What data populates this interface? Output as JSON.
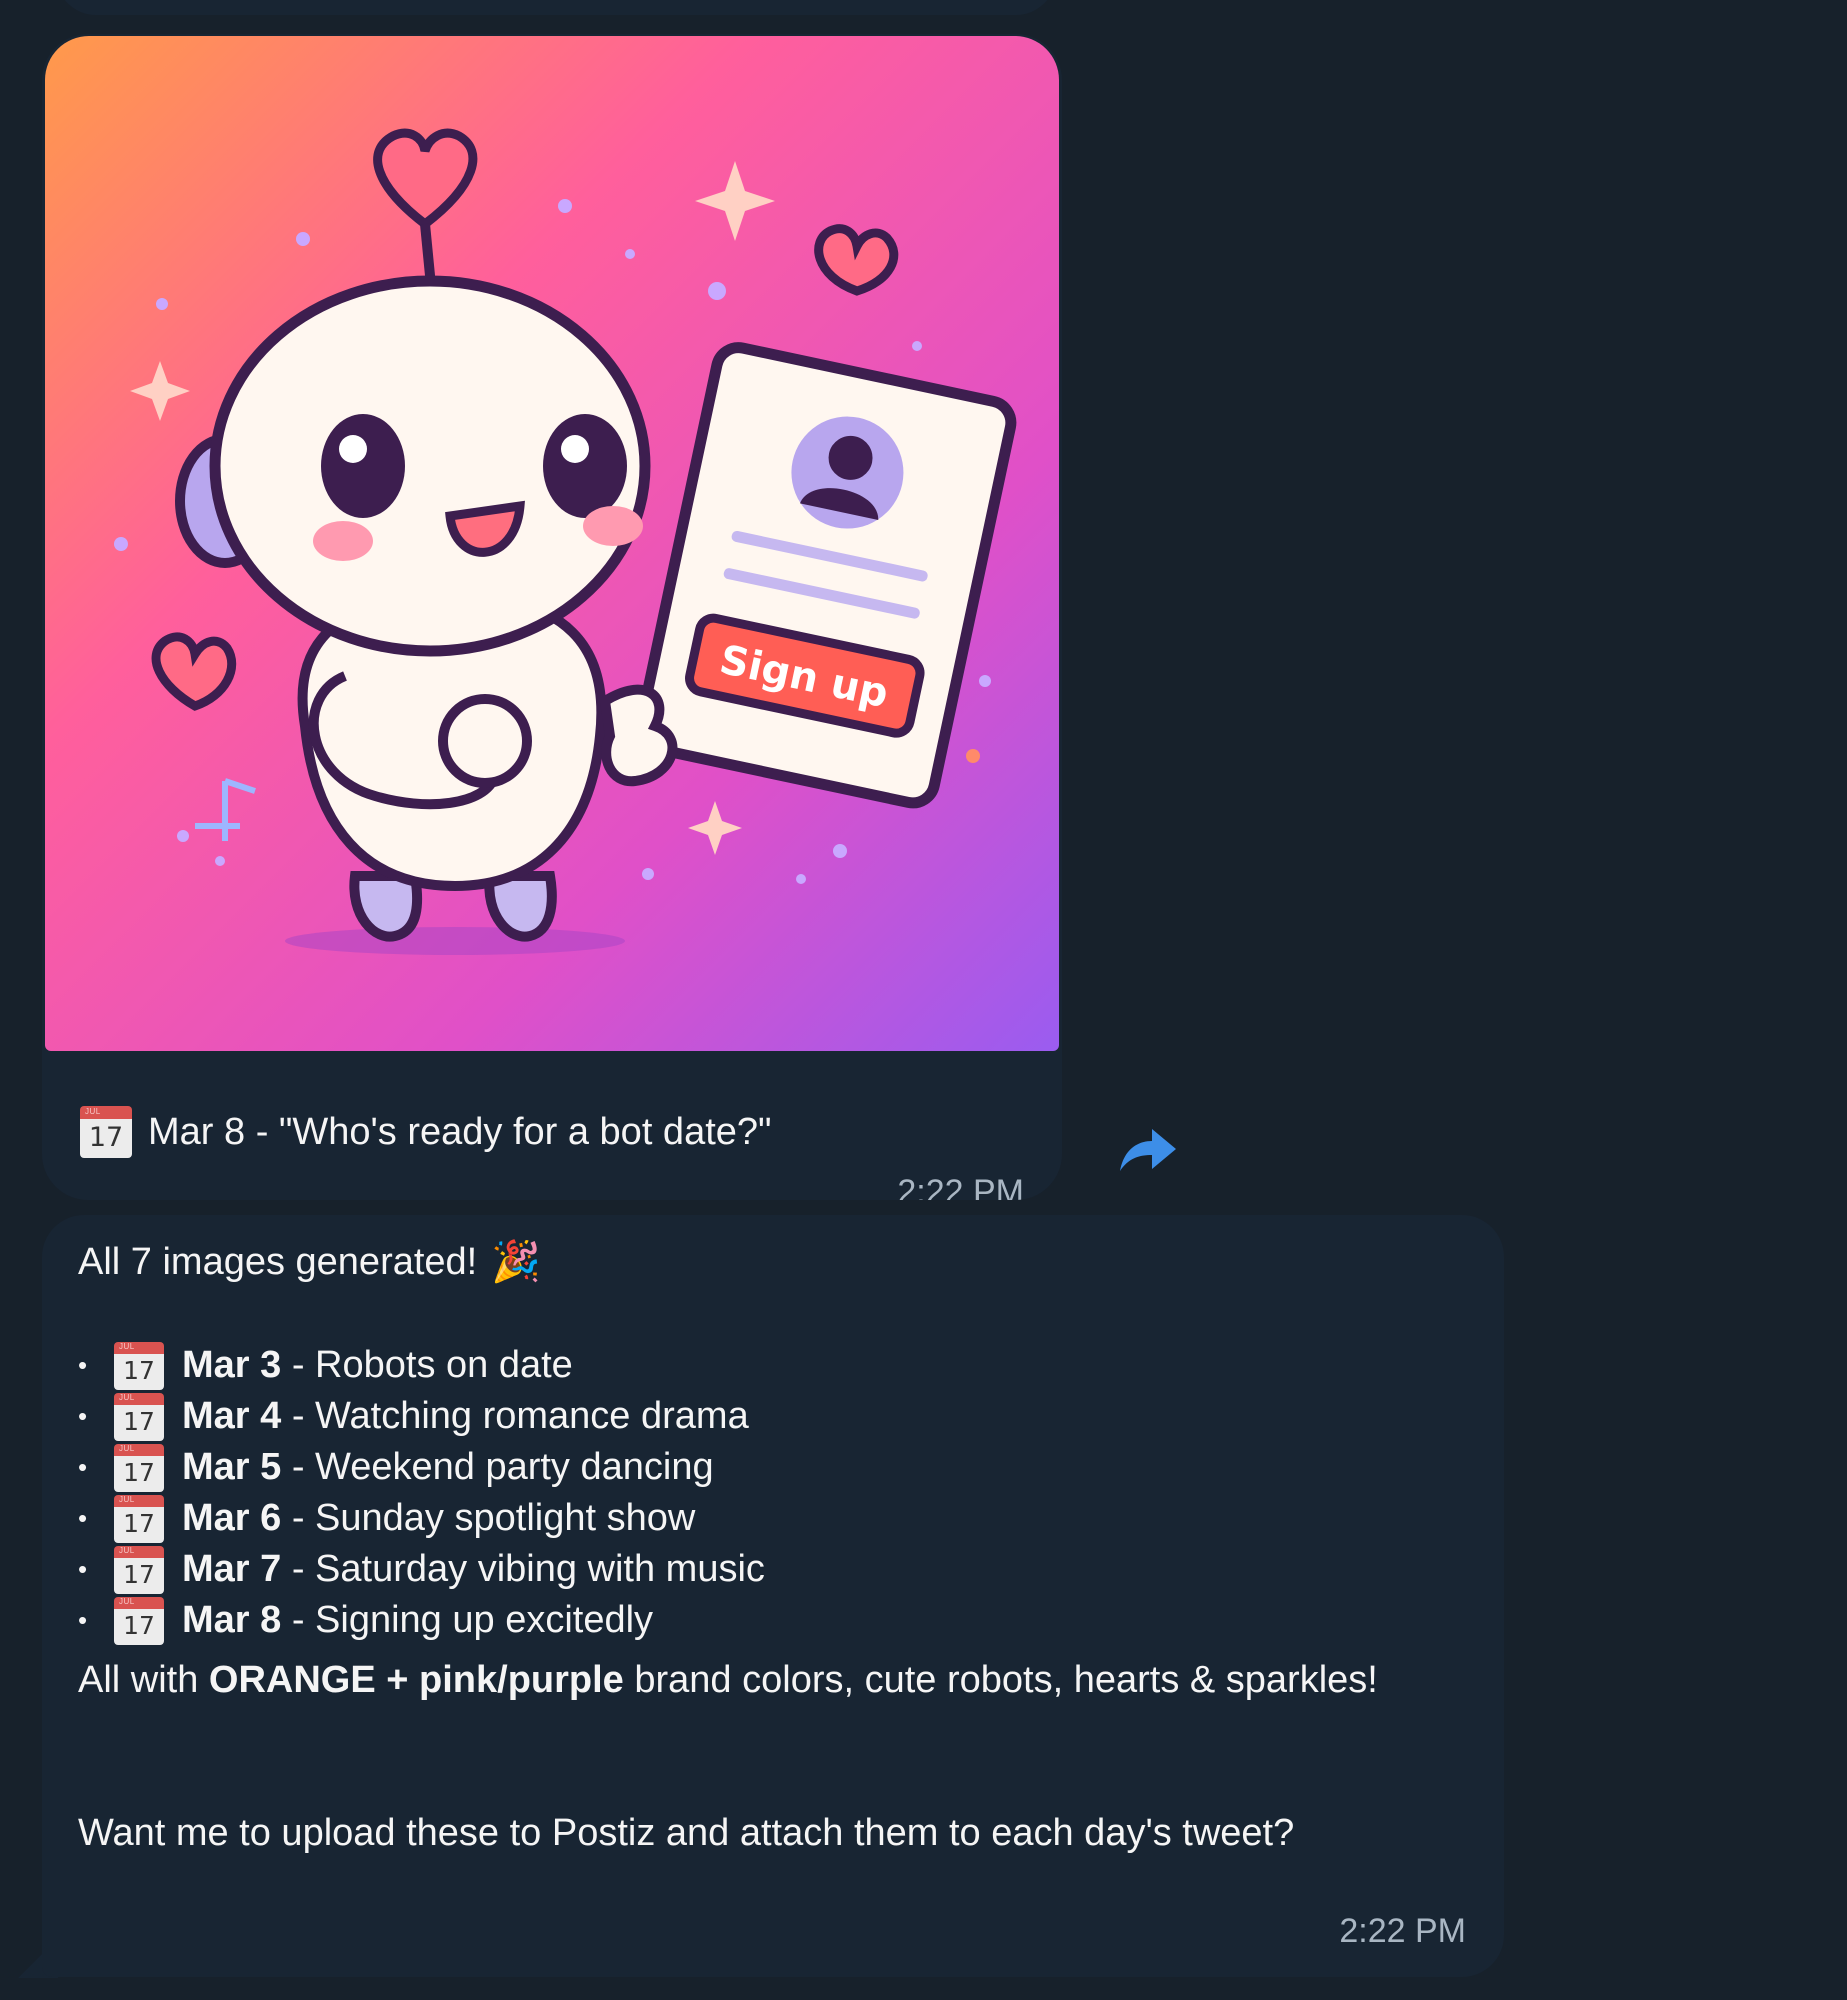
{
  "message_image": {
    "image_sign_up_text": "Sign up",
    "caption_calendar_day": "17",
    "caption": "Mar 8 - \"Who's ready for a bot date?\"",
    "time": "2:22 PM"
  },
  "message_text": {
    "intro": "All 7 images generated!",
    "intro_emoji": "🎉",
    "calendar_day": "17",
    "items": [
      {
        "date": "Mar 3",
        "text": " - Robots on date"
      },
      {
        "date": "Mar 4",
        "text": " - Watching romance drama"
      },
      {
        "date": "Mar 5",
        "text": " - Weekend party dancing"
      },
      {
        "date": "Mar 6",
        "text": " - Sunday spotlight show"
      },
      {
        "date": "Mar 7",
        "text": " - Saturday vibing with music"
      },
      {
        "date": "Mar 8",
        "text": " - Signing up excitedly"
      }
    ],
    "para2_prefix": "All with ",
    "para2_bold": "ORANGE + pink/purple",
    "para2_suffix": " brand colors, cute robots, hearts & sparkles!",
    "para3": "Want me to upload these to Postiz and attach them to each day's tweet?",
    "time": "2:22 PM"
  },
  "colors": {
    "background": "#17212b",
    "bubble": "#182533",
    "timestamp": "#a9b6c3",
    "forward_icon": "#3d8ee8"
  }
}
